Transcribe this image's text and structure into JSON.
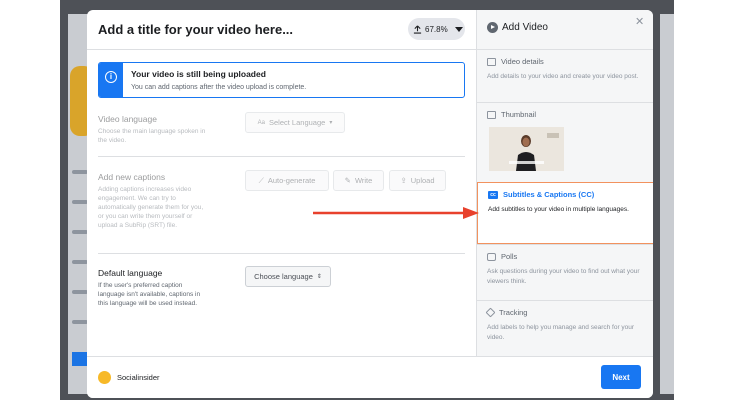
{
  "header": {
    "title": "Add a title for your video here...",
    "upload_progress": "67.8%"
  },
  "notice": {
    "title": "Your video is still being uploaded",
    "message": "You can add captions after the video upload is complete."
  },
  "video_language": {
    "heading": "Video language",
    "description": "Choose the main language spoken in the video.",
    "select_label": "Select Language"
  },
  "captions": {
    "heading": "Add new captions",
    "description": "Adding captions increases video engagement. We can try to automatically generate them for you, or you can write them yourself or upload a SubRip (SRT) file.",
    "auto_label": "Auto-generate",
    "write_label": "Write",
    "upload_label": "Upload"
  },
  "default_language": {
    "heading": "Default language",
    "description": "If the user's preferred caption language isn't available, captions in this language will be used instead.",
    "select_label": "Choose language"
  },
  "sidebar": {
    "title": "Add Video",
    "items": [
      {
        "label": "Video details",
        "description": "Add details to your video and create your video post.",
        "icon": "details-icon"
      },
      {
        "label": "Thumbnail",
        "description": "",
        "icon": "image-icon"
      },
      {
        "label": "Subtitles & Captions (CC)",
        "description": "Add subtitles to your video in multiple languages.",
        "icon": "cc-icon",
        "active": true
      },
      {
        "label": "Polls",
        "description": "Ask questions during your video to find out what your viewers think.",
        "icon": "poll-icon"
      },
      {
        "label": "Tracking",
        "description": "Add labels to help you manage and search for your video.",
        "icon": "tag-icon"
      }
    ]
  },
  "footer": {
    "page_name": "Socialinsider",
    "next_label": "Next"
  },
  "colors": {
    "accent": "#1877f2",
    "highlight_border": "#f2925e",
    "arrow": "#e8412c"
  }
}
